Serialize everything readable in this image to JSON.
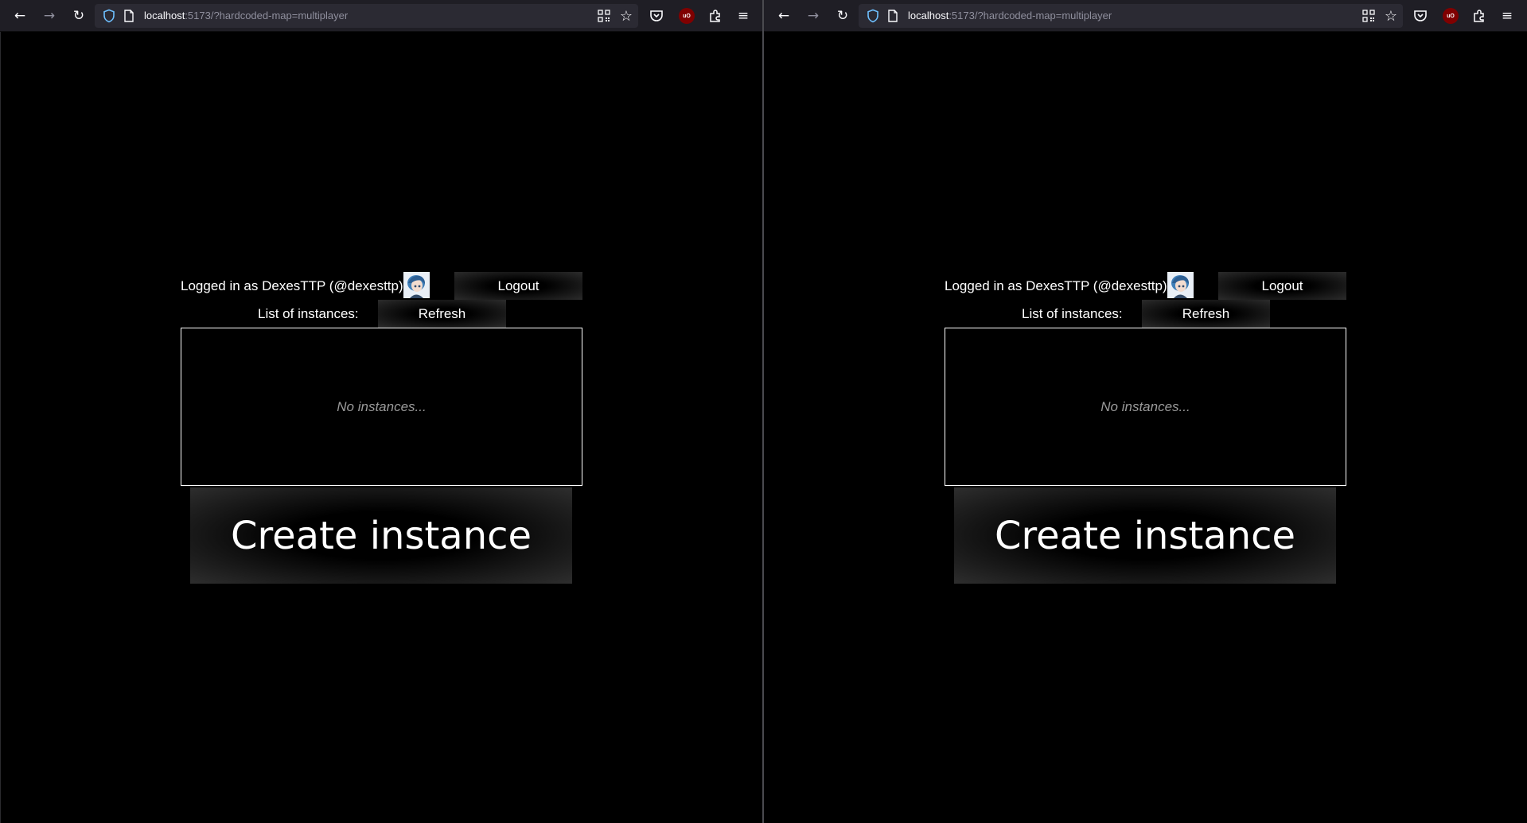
{
  "windows": [
    {
      "id": "left",
      "url": {
        "host": "localhost",
        "rest": ":5173/?hardcoded-map=multiplayer"
      },
      "user_text": "Logged in as DexesTTP (@dexesttp)",
      "logout_label": "Logout",
      "list_label": "List of instances:",
      "refresh_label": "Refresh",
      "empty_text": "No instances...",
      "create_label": "Create instance",
      "ublock_label": "uO"
    },
    {
      "id": "right",
      "url": {
        "host": "localhost",
        "rest": ":5173/?hardcoded-map=multiplayer"
      },
      "user_text": "Logged in as DexesTTP (@dexesttp)",
      "logout_label": "Logout",
      "list_label": "List of instances:",
      "refresh_label": "Refresh",
      "empty_text": "No instances...",
      "create_label": "Create instance",
      "ublock_label": "uO"
    }
  ],
  "toolbar_icons": [
    "back-icon",
    "forward-icon",
    "reload-icon",
    "tracking-shield-icon",
    "page-icon",
    "qr-code-icon",
    "bookmark-star-icon",
    "save-to-pocket-icon",
    "ublock-icon",
    "extensions-icon",
    "menu-icon"
  ],
  "colors": {
    "page_bg": "#000000",
    "toolbar_bg": "#1f1e25",
    "urlbar_bg": "#2b2a33",
    "text": "#ffffff",
    "muted_text": "#9a9a9a",
    "box_border": "#ffffff",
    "ublock_red": "#800000"
  }
}
